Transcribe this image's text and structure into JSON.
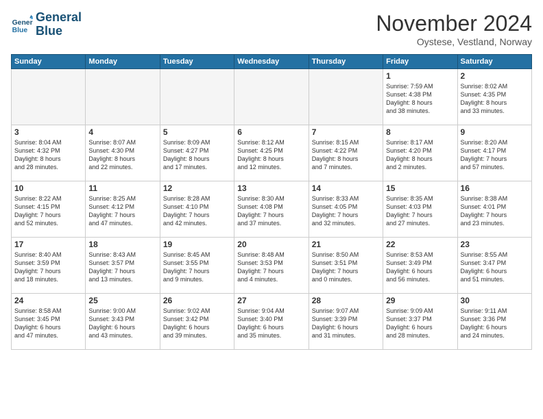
{
  "logo": {
    "line1": "General",
    "line2": "Blue"
  },
  "title": "November 2024",
  "location": "Oystese, Vestland, Norway",
  "weekdays": [
    "Sunday",
    "Monday",
    "Tuesday",
    "Wednesday",
    "Thursday",
    "Friday",
    "Saturday"
  ],
  "weeks": [
    [
      {
        "day": "",
        "info": ""
      },
      {
        "day": "",
        "info": ""
      },
      {
        "day": "",
        "info": ""
      },
      {
        "day": "",
        "info": ""
      },
      {
        "day": "",
        "info": ""
      },
      {
        "day": "1",
        "info": "Sunrise: 7:59 AM\nSunset: 4:38 PM\nDaylight: 8 hours\nand 38 minutes."
      },
      {
        "day": "2",
        "info": "Sunrise: 8:02 AM\nSunset: 4:35 PM\nDaylight: 8 hours\nand 33 minutes."
      }
    ],
    [
      {
        "day": "3",
        "info": "Sunrise: 8:04 AM\nSunset: 4:32 PM\nDaylight: 8 hours\nand 28 minutes."
      },
      {
        "day": "4",
        "info": "Sunrise: 8:07 AM\nSunset: 4:30 PM\nDaylight: 8 hours\nand 22 minutes."
      },
      {
        "day": "5",
        "info": "Sunrise: 8:09 AM\nSunset: 4:27 PM\nDaylight: 8 hours\nand 17 minutes."
      },
      {
        "day": "6",
        "info": "Sunrise: 8:12 AM\nSunset: 4:25 PM\nDaylight: 8 hours\nand 12 minutes."
      },
      {
        "day": "7",
        "info": "Sunrise: 8:15 AM\nSunset: 4:22 PM\nDaylight: 8 hours\nand 7 minutes."
      },
      {
        "day": "8",
        "info": "Sunrise: 8:17 AM\nSunset: 4:20 PM\nDaylight: 8 hours\nand 2 minutes."
      },
      {
        "day": "9",
        "info": "Sunrise: 8:20 AM\nSunset: 4:17 PM\nDaylight: 7 hours\nand 57 minutes."
      }
    ],
    [
      {
        "day": "10",
        "info": "Sunrise: 8:22 AM\nSunset: 4:15 PM\nDaylight: 7 hours\nand 52 minutes."
      },
      {
        "day": "11",
        "info": "Sunrise: 8:25 AM\nSunset: 4:12 PM\nDaylight: 7 hours\nand 47 minutes."
      },
      {
        "day": "12",
        "info": "Sunrise: 8:28 AM\nSunset: 4:10 PM\nDaylight: 7 hours\nand 42 minutes."
      },
      {
        "day": "13",
        "info": "Sunrise: 8:30 AM\nSunset: 4:08 PM\nDaylight: 7 hours\nand 37 minutes."
      },
      {
        "day": "14",
        "info": "Sunrise: 8:33 AM\nSunset: 4:05 PM\nDaylight: 7 hours\nand 32 minutes."
      },
      {
        "day": "15",
        "info": "Sunrise: 8:35 AM\nSunset: 4:03 PM\nDaylight: 7 hours\nand 27 minutes."
      },
      {
        "day": "16",
        "info": "Sunrise: 8:38 AM\nSunset: 4:01 PM\nDaylight: 7 hours\nand 23 minutes."
      }
    ],
    [
      {
        "day": "17",
        "info": "Sunrise: 8:40 AM\nSunset: 3:59 PM\nDaylight: 7 hours\nand 18 minutes."
      },
      {
        "day": "18",
        "info": "Sunrise: 8:43 AM\nSunset: 3:57 PM\nDaylight: 7 hours\nand 13 minutes."
      },
      {
        "day": "19",
        "info": "Sunrise: 8:45 AM\nSunset: 3:55 PM\nDaylight: 7 hours\nand 9 minutes."
      },
      {
        "day": "20",
        "info": "Sunrise: 8:48 AM\nSunset: 3:53 PM\nDaylight: 7 hours\nand 4 minutes."
      },
      {
        "day": "21",
        "info": "Sunrise: 8:50 AM\nSunset: 3:51 PM\nDaylight: 7 hours\nand 0 minutes."
      },
      {
        "day": "22",
        "info": "Sunrise: 8:53 AM\nSunset: 3:49 PM\nDaylight: 6 hours\nand 56 minutes."
      },
      {
        "day": "23",
        "info": "Sunrise: 8:55 AM\nSunset: 3:47 PM\nDaylight: 6 hours\nand 51 minutes."
      }
    ],
    [
      {
        "day": "24",
        "info": "Sunrise: 8:58 AM\nSunset: 3:45 PM\nDaylight: 6 hours\nand 47 minutes."
      },
      {
        "day": "25",
        "info": "Sunrise: 9:00 AM\nSunset: 3:43 PM\nDaylight: 6 hours\nand 43 minutes."
      },
      {
        "day": "26",
        "info": "Sunrise: 9:02 AM\nSunset: 3:42 PM\nDaylight: 6 hours\nand 39 minutes."
      },
      {
        "day": "27",
        "info": "Sunrise: 9:04 AM\nSunset: 3:40 PM\nDaylight: 6 hours\nand 35 minutes."
      },
      {
        "day": "28",
        "info": "Sunrise: 9:07 AM\nSunset: 3:39 PM\nDaylight: 6 hours\nand 31 minutes."
      },
      {
        "day": "29",
        "info": "Sunrise: 9:09 AM\nSunset: 3:37 PM\nDaylight: 6 hours\nand 28 minutes."
      },
      {
        "day": "30",
        "info": "Sunrise: 9:11 AM\nSunset: 3:36 PM\nDaylight: 6 hours\nand 24 minutes."
      }
    ]
  ]
}
